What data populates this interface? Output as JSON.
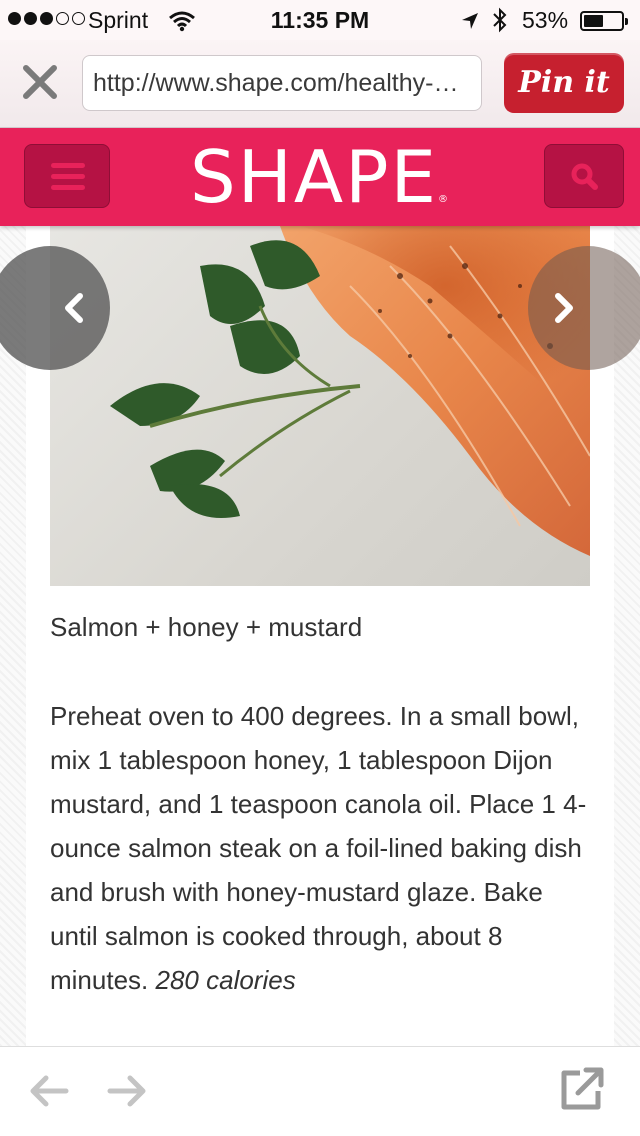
{
  "status_bar": {
    "carrier": "Sprint",
    "time": "11:35 PM",
    "battery_percent": "53%",
    "battery_level": 0.53,
    "signal_bars_filled": 3,
    "signal_bars_total": 5
  },
  "browser": {
    "url": "http://www.shape.com/healthy-…",
    "pin_label": "Pin it",
    "close_icon": "close-icon"
  },
  "site_header": {
    "logo": "SHAPE",
    "logo_mark": "®",
    "menu_icon": "hamburger-icon",
    "search_icon": "search-icon",
    "brand_color": "#e8225a"
  },
  "gallery": {
    "prev_icon": "chevron-left-icon",
    "next_icon": "chevron-right-icon",
    "image_subject": "salmon-with-parsley"
  },
  "article": {
    "caption": "Salmon + honey + mustard",
    "recipe": "Preheat oven to 400 degrees. In a small bowl, mix 1 tablespoon honey, 1 tablespoon Dijon mustard, and 1 teaspoon canola oil. Place 1 4-ounce salmon steak on a foil-lined baking dish and brush with honey-mustard glaze. Bake until salmon is cooked through, about 8 minutes.",
    "calories": "280 calories"
  },
  "toolbar": {
    "back_icon": "arrow-left-icon",
    "forward_icon": "arrow-right-icon",
    "share_icon": "external-link-icon"
  }
}
